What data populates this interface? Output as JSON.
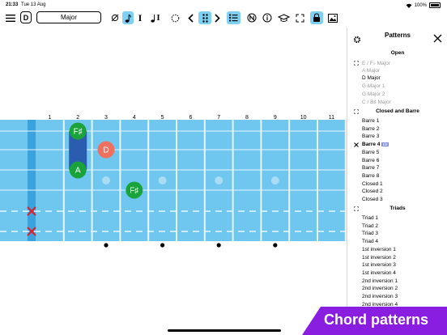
{
  "status": {
    "time": "21:33",
    "date": "Tue 13 Aug",
    "battery": "100%"
  },
  "toolbar": {
    "key_label": "D",
    "mode_label": "Major",
    "icons": [
      "menu-icon",
      "no-notes-icon",
      "note-icon",
      "interval-icon",
      "note-interval-icon",
      "circle-icon",
      "chevron-left-icon",
      "pattern-grid-icon",
      "chevron-right-icon",
      "list-icon",
      "notes-n-icon",
      "info-icon",
      "graduation-cap-icon",
      "fullscreen-icon",
      "lock-icon",
      "image-icon"
    ],
    "interval_glyph": "I"
  },
  "panel": {
    "title": "Patterns",
    "sections": [
      {
        "name": "Open",
        "items": [
          {
            "label": "E / F♭ Major",
            "state": "dim"
          },
          {
            "label": "A Major",
            "state": "dim"
          },
          {
            "label": "D Major",
            "state": "normal"
          },
          {
            "label": "G Major 1",
            "state": "dim"
          },
          {
            "label": "G Major 2",
            "state": "dim"
          },
          {
            "label": "C / B♯ Major",
            "state": "dim"
          }
        ]
      },
      {
        "name": "Closed and Barre",
        "items": [
          {
            "label": "Barre 1",
            "state": "normal"
          },
          {
            "label": "Barre 2",
            "state": "normal"
          },
          {
            "label": "Barre 3",
            "state": "normal"
          },
          {
            "label": "Barre 4",
            "state": "selected",
            "badge": "1/2"
          },
          {
            "label": "Barre 5",
            "state": "normal"
          },
          {
            "label": "Barre 6",
            "state": "normal"
          },
          {
            "label": "Barre 7",
            "state": "normal"
          },
          {
            "label": "Barre 8",
            "state": "normal"
          },
          {
            "label": "Closed 1",
            "state": "normal"
          },
          {
            "label": "Closed 2",
            "state": "normal"
          },
          {
            "label": "Closed 3",
            "state": "normal"
          }
        ]
      },
      {
        "name": "Triads",
        "items": [
          {
            "label": "Triad 1",
            "state": "normal"
          },
          {
            "label": "Triad 2",
            "state": "normal"
          },
          {
            "label": "Triad 3",
            "state": "normal"
          },
          {
            "label": "Triad 4",
            "state": "normal"
          },
          {
            "label": "1st inversion 1",
            "state": "normal"
          },
          {
            "label": "1st inversion 2",
            "state": "normal"
          },
          {
            "label": "1st inversion 3",
            "state": "normal"
          },
          {
            "label": "1st inversion 4",
            "state": "normal"
          },
          {
            "label": "2nd inversion 1",
            "state": "normal"
          },
          {
            "label": "2nd inversion 2",
            "state": "normal"
          },
          {
            "label": "2nd inversion 3",
            "state": "normal"
          },
          {
            "label": "2nd inversion 4",
            "state": "normal"
          }
        ]
      }
    ]
  },
  "fretboard": {
    "fret_numbers": [
      "1",
      "2",
      "3",
      "4",
      "5",
      "6",
      "7",
      "8",
      "9",
      "10",
      "11"
    ],
    "inlay_frets": [
      3,
      5,
      7,
      9
    ],
    "muted_strings": [
      5,
      6
    ],
    "notes": [
      {
        "label": "F♯",
        "fret": 2,
        "string": 1,
        "color": "#1aa33b"
      },
      {
        "label": "D",
        "fret": 3,
        "string": 2,
        "color": "#f07060"
      },
      {
        "label": "A",
        "fret": 2,
        "string": 3,
        "color": "#1aa33b"
      },
      {
        "label": "F♯",
        "fret": 4,
        "string": 4,
        "color": "#1aa33b"
      }
    ],
    "colors": {
      "board": "#6fc6ef",
      "nut": "#3aa2dd",
      "barre": "#2a5cb0",
      "mute": "#e01f26",
      "accent": "#7ed1f3"
    }
  },
  "promo": {
    "text": "Chord patterns",
    "color": "#8a1ee0"
  }
}
